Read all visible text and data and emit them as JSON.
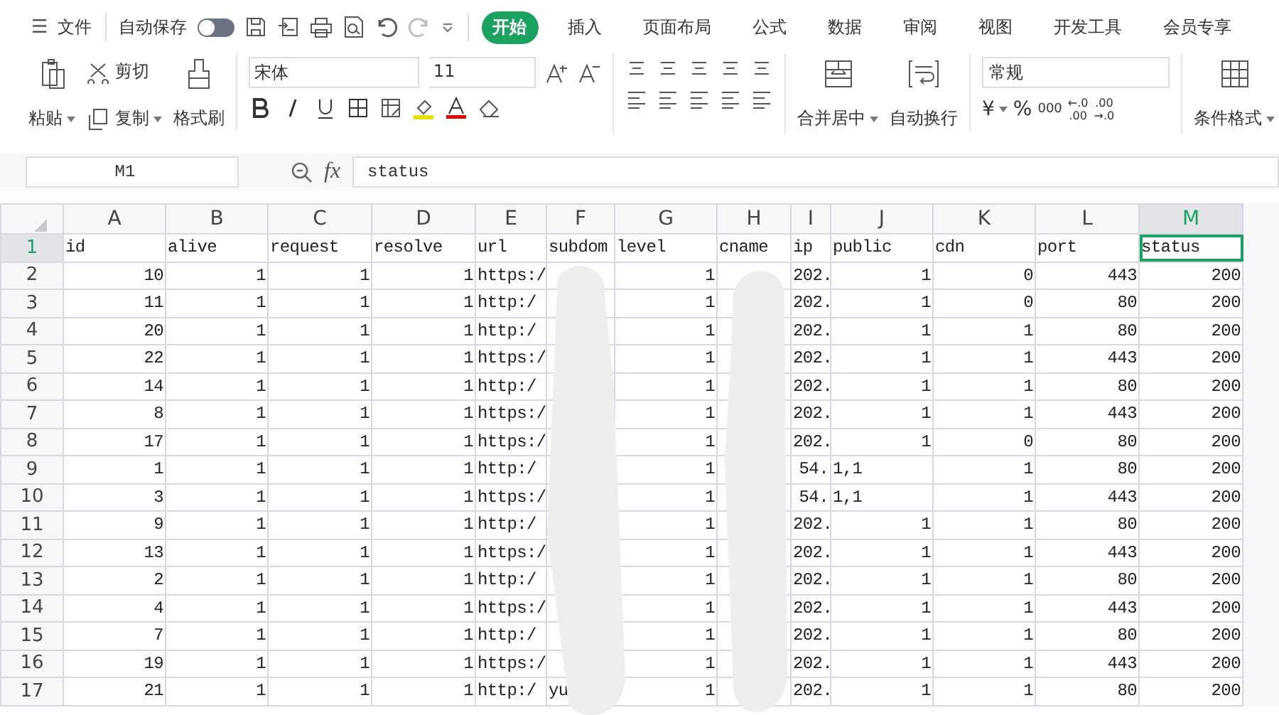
{
  "menu_bar": {
    "menu_icon": "☰",
    "file": "文件",
    "autosave": {
      "label": "自动保存",
      "on": false
    },
    "tabs": [
      {
        "label": "开始",
        "selected": true
      },
      {
        "label": "插入",
        "selected": false
      },
      {
        "label": "页面布局",
        "selected": false
      },
      {
        "label": "公式",
        "selected": false
      },
      {
        "label": "数据",
        "selected": false
      },
      {
        "label": "审阅",
        "selected": false
      },
      {
        "label": "视图",
        "selected": false
      },
      {
        "label": "开发工具",
        "selected": false
      },
      {
        "label": "会员专享",
        "selected": false
      }
    ]
  },
  "ribbon": {
    "paste": "粘贴",
    "cut": "剪切",
    "copy": "复制",
    "format_painter": "格式刷",
    "font": "宋体",
    "font_size": "11",
    "merge_center": "合并居中",
    "wrap_text": "自动换行",
    "number_format": "常规",
    "currency": "¥",
    "percent": "%",
    "thousands": "000",
    "increase_decimal": [
      "←.0",
      ".00"
    ],
    "decrease_decimal": [
      ".00",
      "→.0"
    ],
    "conditional_format": "条件格式"
  },
  "formula_bar": {
    "name_box": "M1",
    "fx": "fx",
    "value": "status"
  },
  "sheet": {
    "columns": [
      {
        "letter": "A",
        "selected": false
      },
      {
        "letter": "B",
        "selected": false
      },
      {
        "letter": "C",
        "selected": false
      },
      {
        "letter": "D",
        "selected": false
      },
      {
        "letter": "E",
        "selected": false
      },
      {
        "letter": "F",
        "selected": false
      },
      {
        "letter": "G",
        "selected": false
      },
      {
        "letter": "H",
        "selected": false
      },
      {
        "letter": "I",
        "selected": false
      },
      {
        "letter": "J",
        "selected": false
      },
      {
        "letter": "K",
        "selected": false
      },
      {
        "letter": "L",
        "selected": false
      },
      {
        "letter": "M",
        "selected": true
      }
    ],
    "rows": [
      {
        "number": "1",
        "selected": true,
        "cells": [
          "id",
          "alive",
          "request",
          "resolve",
          "url",
          "subdom",
          "level",
          "cname",
          "ip",
          "public",
          "cdn",
          "port",
          "status"
        ]
      },
      {
        "number": "2",
        "selected": false,
        "cells": [
          "10",
          "1",
          "1",
          "1",
          "https:/",
          "",
          "1",
          "",
          "202.",
          "1",
          "0",
          "443",
          "200"
        ]
      },
      {
        "number": "3",
        "selected": false,
        "cells": [
          "11",
          "1",
          "1",
          "1",
          "http:/",
          "",
          "1",
          "",
          "202.",
          "1",
          "0",
          "80",
          "200"
        ]
      },
      {
        "number": "4",
        "selected": false,
        "cells": [
          "20",
          "1",
          "1",
          "1",
          "http:/",
          "",
          "1",
          "",
          "202.",
          "1",
          "1",
          "80",
          "200"
        ]
      },
      {
        "number": "5",
        "selected": false,
        "cells": [
          "22",
          "1",
          "1",
          "1",
          "https:/",
          "",
          "1",
          "",
          "202.",
          "1",
          "1",
          "443",
          "200"
        ]
      },
      {
        "number": "6",
        "selected": false,
        "cells": [
          "14",
          "1",
          "1",
          "1",
          "http:/",
          "",
          "1",
          "",
          "202.",
          "1",
          "1",
          "80",
          "200"
        ]
      },
      {
        "number": "7",
        "selected": false,
        "cells": [
          "8",
          "1",
          "1",
          "1",
          "https:/",
          "",
          "1",
          "",
          "202.",
          "1",
          "1",
          "443",
          "200"
        ]
      },
      {
        "number": "8",
        "selected": false,
        "cells": [
          "17",
          "1",
          "1",
          "1",
          "https:/",
          "",
          "1",
          "",
          "202.",
          "1",
          "0",
          "80",
          "200"
        ]
      },
      {
        "number": "9",
        "selected": false,
        "cells": [
          "1",
          "1",
          "1",
          "1",
          "http:/",
          "",
          "1",
          "",
          "54.",
          "1,1",
          "1",
          "80",
          "200"
        ]
      },
      {
        "number": "10",
        "selected": false,
        "cells": [
          "3",
          "1",
          "1",
          "1",
          "https:/",
          "",
          "1",
          "",
          "54.",
          "1,1",
          "1",
          "443",
          "200"
        ]
      },
      {
        "number": "11",
        "selected": false,
        "cells": [
          "9",
          "1",
          "1",
          "1",
          "http:/",
          "",
          "1",
          "",
          "202.",
          "1",
          "1",
          "80",
          "200"
        ]
      },
      {
        "number": "12",
        "selected": false,
        "cells": [
          "13",
          "1",
          "1",
          "1",
          "https:/",
          "",
          "1",
          "",
          "202.",
          "1",
          "1",
          "443",
          "200"
        ]
      },
      {
        "number": "13",
        "selected": false,
        "cells": [
          "2",
          "1",
          "1",
          "1",
          "http:/",
          "",
          "1",
          "",
          "202.",
          "1",
          "1",
          "80",
          "200"
        ]
      },
      {
        "number": "14",
        "selected": false,
        "cells": [
          "4",
          "1",
          "1",
          "1",
          "https:/",
          "",
          "1",
          "",
          "202.",
          "1",
          "1",
          "443",
          "200"
        ]
      },
      {
        "number": "15",
        "selected": false,
        "cells": [
          "7",
          "1",
          "1",
          "1",
          "http:/",
          "",
          "1",
          "",
          "202.",
          "1",
          "1",
          "80",
          "200"
        ]
      },
      {
        "number": "16",
        "selected": false,
        "cells": [
          "19",
          "1",
          "1",
          "1",
          "https:/",
          "",
          "1",
          "",
          "202.",
          "1",
          "1",
          "443",
          "200"
        ]
      },
      {
        "number": "17",
        "selected": false,
        "cells": [
          "21",
          "1",
          "1",
          "1",
          "http:/",
          "yu",
          "1",
          "",
          "202.",
          "1",
          "1",
          "80",
          "200"
        ]
      }
    ]
  }
}
